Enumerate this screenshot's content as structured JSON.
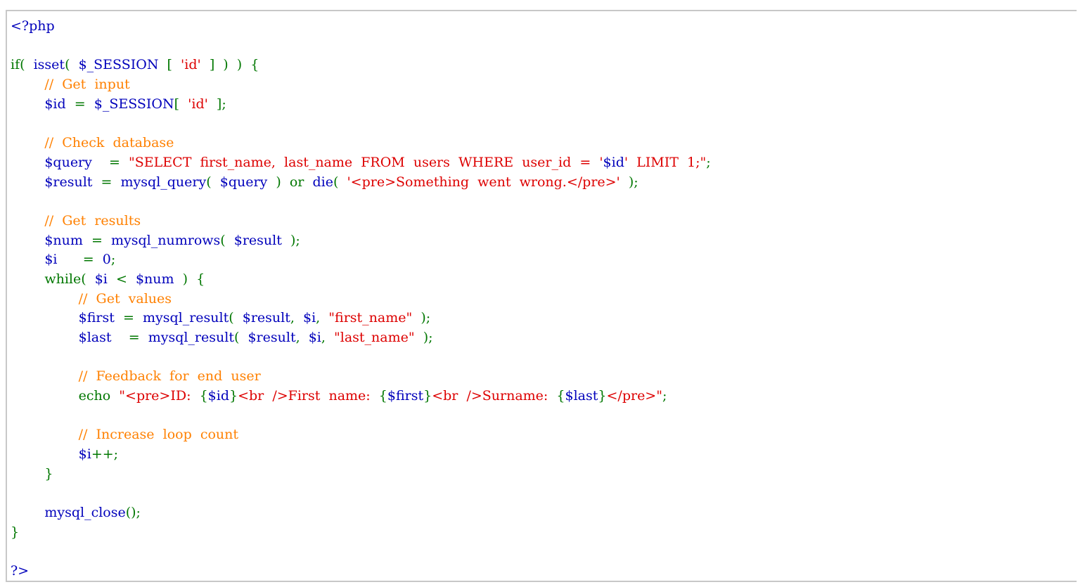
{
  "colors": {
    "default": "#0000BB",
    "keyword": "#007700",
    "string": "#DD0000",
    "comment": "#FF8000",
    "background": "#FFFFFF",
    "border": "#C8C8C8"
  },
  "source_lines": [
    [
      [
        "default",
        "<?php"
      ]
    ],
    [],
    [
      [
        "keyword",
        "if(  "
      ],
      [
        "default",
        "isset"
      ],
      [
        "keyword",
        "(  "
      ],
      [
        "default",
        "$_SESSION  "
      ],
      [
        "keyword",
        "[  "
      ],
      [
        "string",
        "'id'  "
      ],
      [
        "keyword",
        "]  )  )  {"
      ]
    ],
    [
      [
        "keyword",
        "        "
      ],
      [
        "comment",
        "//  Get  input"
      ]
    ],
    [
      [
        "keyword",
        "        "
      ],
      [
        "default",
        "$id  "
      ],
      [
        "keyword",
        "=  "
      ],
      [
        "default",
        "$_SESSION"
      ],
      [
        "keyword",
        "[  "
      ],
      [
        "string",
        "'id'  "
      ],
      [
        "keyword",
        "];"
      ]
    ],
    [],
    [
      [
        "keyword",
        "        "
      ],
      [
        "comment",
        "//  Check  database"
      ]
    ],
    [
      [
        "keyword",
        "        "
      ],
      [
        "default",
        "$query    "
      ],
      [
        "keyword",
        "=  "
      ],
      [
        "string",
        "\"SELECT  first_name,  last_name  FROM  users  WHERE  user_id  =  '"
      ],
      [
        "default",
        "$id"
      ],
      [
        "string",
        "'  LIMIT  1;\""
      ],
      [
        "keyword",
        ";"
      ]
    ],
    [
      [
        "keyword",
        "        "
      ],
      [
        "default",
        "$result  "
      ],
      [
        "keyword",
        "=  "
      ],
      [
        "default",
        "mysql_query"
      ],
      [
        "keyword",
        "(  "
      ],
      [
        "default",
        "$query  "
      ],
      [
        "keyword",
        ")  or  "
      ],
      [
        "default",
        "die"
      ],
      [
        "keyword",
        "(  "
      ],
      [
        "string",
        "'<pre>Something  went  wrong.</pre>'  "
      ],
      [
        "keyword",
        ");"
      ]
    ],
    [],
    [
      [
        "keyword",
        "        "
      ],
      [
        "comment",
        "//  Get  results"
      ]
    ],
    [
      [
        "keyword",
        "        "
      ],
      [
        "default",
        "$num  "
      ],
      [
        "keyword",
        "=  "
      ],
      [
        "default",
        "mysql_numrows"
      ],
      [
        "keyword",
        "(  "
      ],
      [
        "default",
        "$result  "
      ],
      [
        "keyword",
        ");"
      ]
    ],
    [
      [
        "keyword",
        "        "
      ],
      [
        "default",
        "$i      "
      ],
      [
        "keyword",
        "=  "
      ],
      [
        "default",
        "0"
      ],
      [
        "keyword",
        ";"
      ]
    ],
    [
      [
        "keyword",
        "        while(  "
      ],
      [
        "default",
        "$i  "
      ],
      [
        "keyword",
        "<  "
      ],
      [
        "default",
        "$num  "
      ],
      [
        "keyword",
        ")  {"
      ]
    ],
    [
      [
        "keyword",
        "                "
      ],
      [
        "comment",
        "//  Get  values"
      ]
    ],
    [
      [
        "keyword",
        "                "
      ],
      [
        "default",
        "$first  "
      ],
      [
        "keyword",
        "=  "
      ],
      [
        "default",
        "mysql_result"
      ],
      [
        "keyword",
        "(  "
      ],
      [
        "default",
        "$result"
      ],
      [
        "keyword",
        ",  "
      ],
      [
        "default",
        "$i"
      ],
      [
        "keyword",
        ",  "
      ],
      [
        "string",
        "\"first_name\"  "
      ],
      [
        "keyword",
        ");"
      ]
    ],
    [
      [
        "keyword",
        "                "
      ],
      [
        "default",
        "$last    "
      ],
      [
        "keyword",
        "=  "
      ],
      [
        "default",
        "mysql_result"
      ],
      [
        "keyword",
        "(  "
      ],
      [
        "default",
        "$result"
      ],
      [
        "keyword",
        ",  "
      ],
      [
        "default",
        "$i"
      ],
      [
        "keyword",
        ",  "
      ],
      [
        "string",
        "\"last_name\"  "
      ],
      [
        "keyword",
        ");"
      ]
    ],
    [],
    [
      [
        "keyword",
        "                "
      ],
      [
        "comment",
        "//  Feedback  for  end  user"
      ]
    ],
    [
      [
        "keyword",
        "                echo  "
      ],
      [
        "string",
        "\"<pre>ID:  "
      ],
      [
        "keyword",
        "{"
      ],
      [
        "default",
        "$id"
      ],
      [
        "keyword",
        "}"
      ],
      [
        "string",
        "<br  />First  name:  "
      ],
      [
        "keyword",
        "{"
      ],
      [
        "default",
        "$first"
      ],
      [
        "keyword",
        "}"
      ],
      [
        "string",
        "<br  />Surname:  "
      ],
      [
        "keyword",
        "{"
      ],
      [
        "default",
        "$last"
      ],
      [
        "keyword",
        "}"
      ],
      [
        "string",
        "</pre>\""
      ],
      [
        "keyword",
        ";"
      ]
    ],
    [],
    [
      [
        "keyword",
        "                "
      ],
      [
        "comment",
        "//  Increase  loop  count"
      ]
    ],
    [
      [
        "keyword",
        "                "
      ],
      [
        "default",
        "$i"
      ],
      [
        "keyword",
        "++;"
      ]
    ],
    [
      [
        "keyword",
        "        }"
      ]
    ],
    [],
    [
      [
        "keyword",
        "        "
      ],
      [
        "default",
        "mysql_close"
      ],
      [
        "keyword",
        "();"
      ]
    ],
    [
      [
        "keyword",
        "}"
      ]
    ],
    [],
    [
      [
        "default",
        "?>"
      ]
    ]
  ]
}
